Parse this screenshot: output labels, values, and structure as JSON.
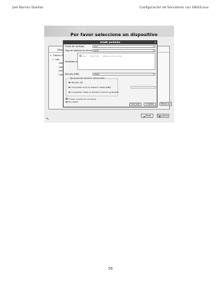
{
  "header": {
    "author": "Joel Barrios Dueñas",
    "doc_title": "Configuración de Servidores con GNU/Linux"
  },
  "installer": {
    "title": "Por favor seleccione un dispositivo",
    "devices_tab": "Dispositivo",
    "tree": [
      "Discos duros",
      "sda",
      "sda1",
      "sda2",
      "sda3",
      "Libre"
    ],
    "reinit_label": "Reiniciar",
    "back_label": "Atrás",
    "next_label": "Siguiente"
  },
  "dialog": {
    "title": "Añadir partición",
    "mount_label": "Punto de montaje:",
    "mount_value": "/srv",
    "fstype_label": "Tipo de sistema de archivos:",
    "fstype_value": "ext4",
    "drives_label": "Unidades admisibles:",
    "drive_row": [
      "sda",
      "8191 MB",
      "VMware Virtual disk"
    ],
    "size_label": "Tamaño (MB):",
    "size_value": "1024",
    "extra_title": "Opciones de tamaño adicionales",
    "opt_fixed": "Tamaño fijo",
    "opt_fill_up_to": "Completar todo el espacio hasta (MB):",
    "opt_fill_max": "Completar hasta el tamaño máximo grabable",
    "force_primary": "Forzar a partición primaria",
    "encrypt": "Encriptar",
    "cancel_label": "Cancelar",
    "ok_label": "Aceptar"
  },
  "page_number": "56"
}
